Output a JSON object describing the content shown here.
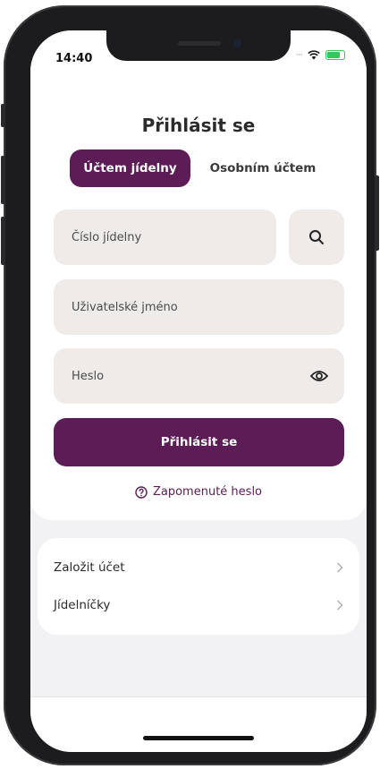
{
  "status": {
    "time": "14:40"
  },
  "login": {
    "title": "Přihlásit se",
    "tabs": [
      {
        "label": "Účtem jídelny",
        "active": true
      },
      {
        "label": "Osobním účtem",
        "active": false
      }
    ],
    "fields": {
      "canteen_number": {
        "placeholder": "Číslo jídelny"
      },
      "username": {
        "placeholder": "Uživatelské jméno"
      },
      "password": {
        "placeholder": "Heslo"
      }
    },
    "submit_label": "Přihlásit se",
    "forgot_label": "Zapomenuté heslo"
  },
  "links": [
    {
      "label": "Založit účet"
    },
    {
      "label": "Jídelníčky"
    }
  ],
  "colors": {
    "accent": "#5c1c55",
    "field_bg": "#efebe9",
    "battery": "#34c759"
  }
}
